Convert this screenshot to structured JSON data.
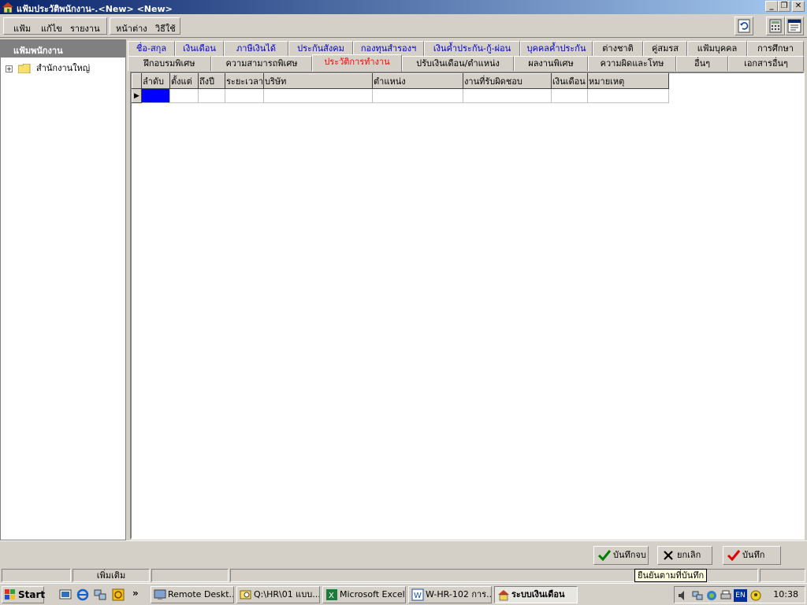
{
  "window": {
    "title": "แฟ้มประวัติพนักงาน-.<New> <New>",
    "minimize": "_",
    "restore": "❐",
    "close": "✕"
  },
  "menu": {
    "file": "แฟ้ม",
    "edit": "แก้ไข",
    "report": "รายงาน",
    "window": "หน้าต่าง",
    "help": "วิธีใช้"
  },
  "sidebar": {
    "header": "แฟ้มพนักงาน",
    "tree": [
      {
        "label": "สำนักงานใหญ่",
        "expander": "+"
      }
    ]
  },
  "tabs": {
    "row1": [
      {
        "label": "ชื่อ-สกุล"
      },
      {
        "label": "เงินเดือน"
      },
      {
        "label": "ภาษีเงินได้"
      },
      {
        "label": "ประกันสังคม"
      },
      {
        "label": "กองทุนสำรองฯ"
      },
      {
        "label": "เงินค้ำประกัน-กู้-ผ่อน"
      },
      {
        "label": "บุคคลค้ำประกัน"
      },
      {
        "label": "ต่างชาติ"
      },
      {
        "label": "คู่สมรส"
      },
      {
        "label": "แฟ้มบุคคล"
      },
      {
        "label": "การศึกษา"
      }
    ],
    "row2": [
      {
        "label": "ฝึกอบรมพิเศษ"
      },
      {
        "label": "ความสามารถพิเศษ"
      },
      {
        "label": "ประวัติการทำงาน"
      },
      {
        "label": "ปรับเงินเดือน/ตำแหน่ง"
      },
      {
        "label": "ผลงานพิเศษ"
      },
      {
        "label": "ความผิดและโทษ"
      },
      {
        "label": "อื่นๆ"
      },
      {
        "label": "เอกสารอื่นๆ"
      }
    ],
    "active_tab": "ประวัติการทำงาน"
  },
  "grid": {
    "columns": [
      "ลำดับ",
      "ตั้งแต่",
      "ถึงปี",
      "ระยะเวลา",
      "บริษัท",
      "ตำแหน่ง",
      "งานที่รับผิดชอบ",
      "เงินเดือน",
      "หมายเหตุ"
    ],
    "rows": [
      [
        "",
        "",
        "",
        "",
        "",
        "",
        "",
        "",
        ""
      ]
    ],
    "row_indicator": "▶"
  },
  "buttons": {
    "save_close": "บันทึกจบ",
    "cancel": "ยกเลิก",
    "save": "บันทึก"
  },
  "status": {
    "mode": "เพิ่มเติม",
    "tooltip": "ยืนยันตามที่บันทึก"
  },
  "taskbar": {
    "start": "Start",
    "tasks": [
      {
        "label": "Remote Deskt..."
      },
      {
        "label": "Q:\\HR\\01 แบบ..."
      },
      {
        "label": "Microsoft Excel"
      },
      {
        "label": "W-HR-102 การ..."
      },
      {
        "label": "ระบบเงินเดือน"
      }
    ],
    "language": "EN",
    "clock": "10:38"
  },
  "colors": {
    "titlebar_start": "#0a246a",
    "titlebar_end": "#a6caf0",
    "tab_link": "#0000cc",
    "tab_active": "#ff0000",
    "selected_cell": "#0000ff",
    "tooltip_bg": "#ffffe1"
  }
}
